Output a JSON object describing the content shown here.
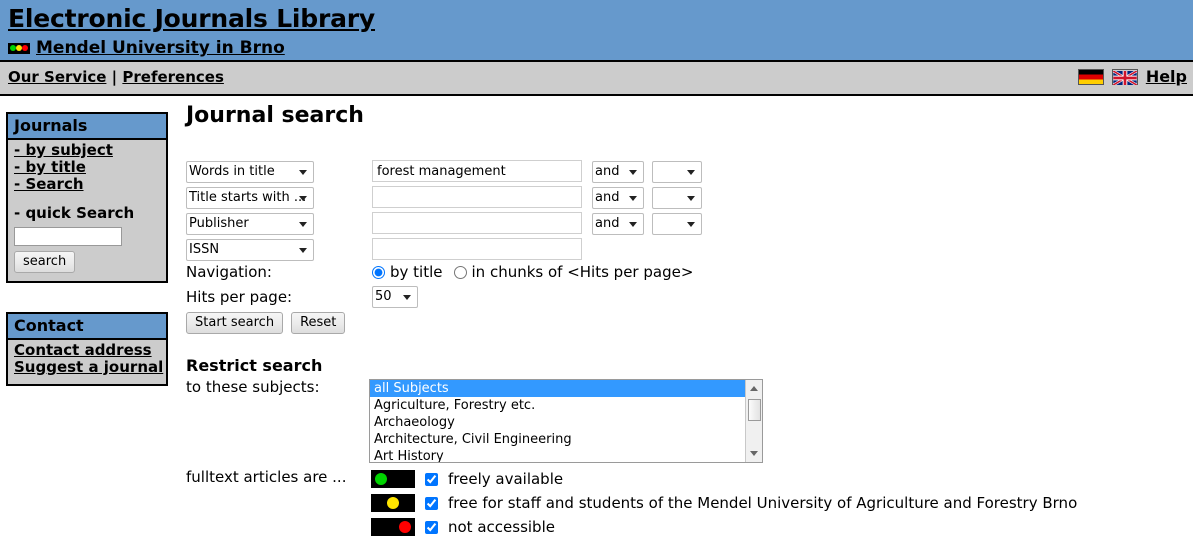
{
  "header": {
    "site_title": "Electronic Journals Library",
    "library_name": "Mendel University in Brno",
    "traffic_light_icon": "traffic-light-icon"
  },
  "navbar": {
    "our_service": "Our Service",
    "separator": "|",
    "preferences": "Preferences",
    "flag_de": "german-flag-icon",
    "flag_en": "uk-flag-icon",
    "help": "Help"
  },
  "sidebar": {
    "journals": {
      "title": "Journals",
      "items": [
        {
          "label": "- by subject"
        },
        {
          "label": "- by title"
        },
        {
          "label": "- Search"
        }
      ],
      "quick_search_label": "- quick Search",
      "quick_search_value": "",
      "quick_search_placeholder": "",
      "search_button": "search"
    },
    "contact": {
      "title": "Contact",
      "items": [
        {
          "label": "Contact address"
        },
        {
          "label": "Suggest a journal"
        }
      ]
    }
  },
  "main": {
    "page_title": "Journal search",
    "rows": [
      {
        "field": "Words in title",
        "value": "forest management",
        "placeholder": "",
        "operator": "and",
        "extra": ""
      },
      {
        "field": "Title starts with ...",
        "value": "",
        "placeholder": "",
        "operator": "and",
        "extra": ""
      },
      {
        "field": "Publisher",
        "value": "",
        "placeholder": "",
        "operator": "and",
        "extra": ""
      },
      {
        "field": "ISSN",
        "value": "",
        "placeholder": "",
        "operator": null,
        "extra": null
      }
    ],
    "navigation_label": "Navigation:",
    "nav_by_title": "by title",
    "nav_in_chunks": "in chunks of <Hits per page>",
    "hits_label": "Hits per page:",
    "hits_value": "50",
    "start_search_button": "Start search",
    "reset_button": "Reset",
    "restrict_title": "Restrict search",
    "restrict_sub": "to these subjects:",
    "subjects": [
      {
        "label": "all Subjects",
        "selected": true
      },
      {
        "label": "Agriculture, Forestry etc.",
        "selected": false
      },
      {
        "label": "Archaeology",
        "selected": false
      },
      {
        "label": "Architecture, Civil Engineering",
        "selected": false
      },
      {
        "label": "Art History",
        "selected": false
      }
    ],
    "fulltext_label": "fulltext articles are ...",
    "fulltext_options": [
      {
        "light": "green",
        "position": "pos-left",
        "checked": true,
        "label": "freely available"
      },
      {
        "light": "yellow",
        "position": "pos-center",
        "checked": true,
        "label": "free for staff and students of the Mendel University of Agriculture and Forestry Brno"
      },
      {
        "light": "red",
        "position": "pos-right",
        "checked": true,
        "label": "not accessible"
      }
    ]
  },
  "colors": {
    "header_blue": "#6699cc",
    "navbar_gray": "#cccccc",
    "selected_blue": "#3399ff",
    "light_green": "#00d400",
    "light_yellow": "#ffe500",
    "light_red": "#ff0000"
  }
}
